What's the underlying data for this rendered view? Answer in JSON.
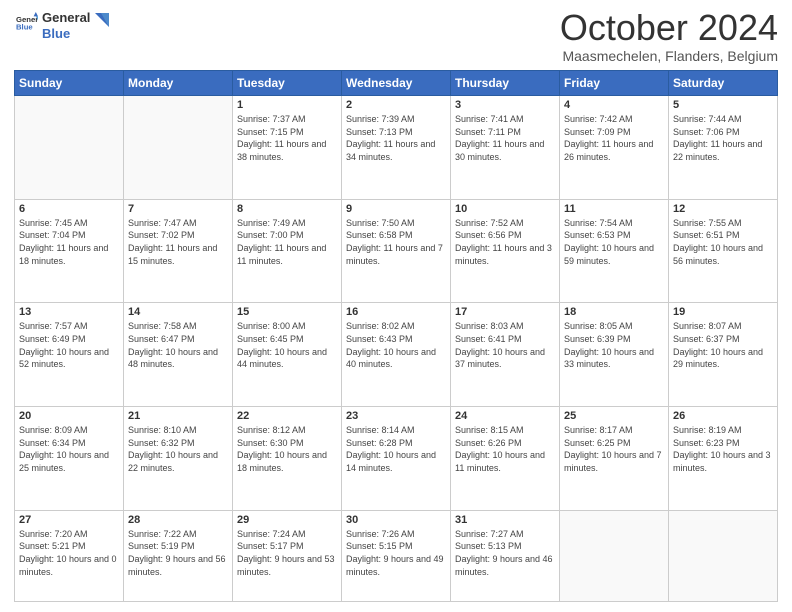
{
  "logo": {
    "line1": "General",
    "line2": "Blue"
  },
  "header": {
    "month": "October 2024",
    "location": "Maasmechelen, Flanders, Belgium"
  },
  "weekdays": [
    "Sunday",
    "Monday",
    "Tuesday",
    "Wednesday",
    "Thursday",
    "Friday",
    "Saturday"
  ],
  "weeks": [
    [
      {
        "day": "",
        "info": ""
      },
      {
        "day": "",
        "info": ""
      },
      {
        "day": "1",
        "info": "Sunrise: 7:37 AM\nSunset: 7:15 PM\nDaylight: 11 hours and 38 minutes."
      },
      {
        "day": "2",
        "info": "Sunrise: 7:39 AM\nSunset: 7:13 PM\nDaylight: 11 hours and 34 minutes."
      },
      {
        "day": "3",
        "info": "Sunrise: 7:41 AM\nSunset: 7:11 PM\nDaylight: 11 hours and 30 minutes."
      },
      {
        "day": "4",
        "info": "Sunrise: 7:42 AM\nSunset: 7:09 PM\nDaylight: 11 hours and 26 minutes."
      },
      {
        "day": "5",
        "info": "Sunrise: 7:44 AM\nSunset: 7:06 PM\nDaylight: 11 hours and 22 minutes."
      }
    ],
    [
      {
        "day": "6",
        "info": "Sunrise: 7:45 AM\nSunset: 7:04 PM\nDaylight: 11 hours and 18 minutes."
      },
      {
        "day": "7",
        "info": "Sunrise: 7:47 AM\nSunset: 7:02 PM\nDaylight: 11 hours and 15 minutes."
      },
      {
        "day": "8",
        "info": "Sunrise: 7:49 AM\nSunset: 7:00 PM\nDaylight: 11 hours and 11 minutes."
      },
      {
        "day": "9",
        "info": "Sunrise: 7:50 AM\nSunset: 6:58 PM\nDaylight: 11 hours and 7 minutes."
      },
      {
        "day": "10",
        "info": "Sunrise: 7:52 AM\nSunset: 6:56 PM\nDaylight: 11 hours and 3 minutes."
      },
      {
        "day": "11",
        "info": "Sunrise: 7:54 AM\nSunset: 6:53 PM\nDaylight: 10 hours and 59 minutes."
      },
      {
        "day": "12",
        "info": "Sunrise: 7:55 AM\nSunset: 6:51 PM\nDaylight: 10 hours and 56 minutes."
      }
    ],
    [
      {
        "day": "13",
        "info": "Sunrise: 7:57 AM\nSunset: 6:49 PM\nDaylight: 10 hours and 52 minutes."
      },
      {
        "day": "14",
        "info": "Sunrise: 7:58 AM\nSunset: 6:47 PM\nDaylight: 10 hours and 48 minutes."
      },
      {
        "day": "15",
        "info": "Sunrise: 8:00 AM\nSunset: 6:45 PM\nDaylight: 10 hours and 44 minutes."
      },
      {
        "day": "16",
        "info": "Sunrise: 8:02 AM\nSunset: 6:43 PM\nDaylight: 10 hours and 40 minutes."
      },
      {
        "day": "17",
        "info": "Sunrise: 8:03 AM\nSunset: 6:41 PM\nDaylight: 10 hours and 37 minutes."
      },
      {
        "day": "18",
        "info": "Sunrise: 8:05 AM\nSunset: 6:39 PM\nDaylight: 10 hours and 33 minutes."
      },
      {
        "day": "19",
        "info": "Sunrise: 8:07 AM\nSunset: 6:37 PM\nDaylight: 10 hours and 29 minutes."
      }
    ],
    [
      {
        "day": "20",
        "info": "Sunrise: 8:09 AM\nSunset: 6:34 PM\nDaylight: 10 hours and 25 minutes."
      },
      {
        "day": "21",
        "info": "Sunrise: 8:10 AM\nSunset: 6:32 PM\nDaylight: 10 hours and 22 minutes."
      },
      {
        "day": "22",
        "info": "Sunrise: 8:12 AM\nSunset: 6:30 PM\nDaylight: 10 hours and 18 minutes."
      },
      {
        "day": "23",
        "info": "Sunrise: 8:14 AM\nSunset: 6:28 PM\nDaylight: 10 hours and 14 minutes."
      },
      {
        "day": "24",
        "info": "Sunrise: 8:15 AM\nSunset: 6:26 PM\nDaylight: 10 hours and 11 minutes."
      },
      {
        "day": "25",
        "info": "Sunrise: 8:17 AM\nSunset: 6:25 PM\nDaylight: 10 hours and 7 minutes."
      },
      {
        "day": "26",
        "info": "Sunrise: 8:19 AM\nSunset: 6:23 PM\nDaylight: 10 hours and 3 minutes."
      }
    ],
    [
      {
        "day": "27",
        "info": "Sunrise: 7:20 AM\nSunset: 5:21 PM\nDaylight: 10 hours and 0 minutes."
      },
      {
        "day": "28",
        "info": "Sunrise: 7:22 AM\nSunset: 5:19 PM\nDaylight: 9 hours and 56 minutes."
      },
      {
        "day": "29",
        "info": "Sunrise: 7:24 AM\nSunset: 5:17 PM\nDaylight: 9 hours and 53 minutes."
      },
      {
        "day": "30",
        "info": "Sunrise: 7:26 AM\nSunset: 5:15 PM\nDaylight: 9 hours and 49 minutes."
      },
      {
        "day": "31",
        "info": "Sunrise: 7:27 AM\nSunset: 5:13 PM\nDaylight: 9 hours and 46 minutes."
      },
      {
        "day": "",
        "info": ""
      },
      {
        "day": "",
        "info": ""
      }
    ]
  ]
}
